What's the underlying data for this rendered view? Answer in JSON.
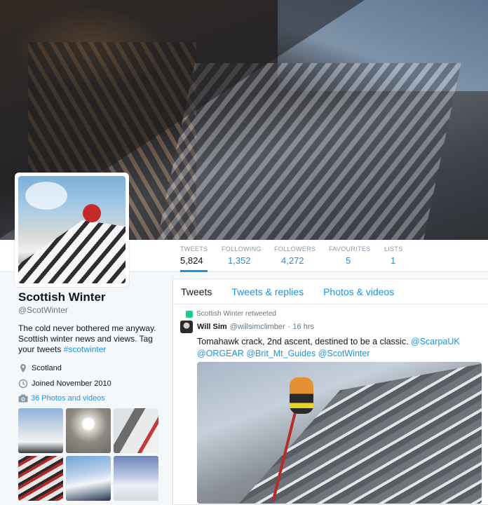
{
  "profile": {
    "name": "Scottish Winter",
    "handle": "@ScotWinter",
    "bio_text": "The cold never bothered me anyway. Scottish winter news and views. Tag your tweets ",
    "bio_hashtag": "#scotwinter",
    "location": "Scotland",
    "joined": "Joined November 2010",
    "photos_link": "36 Photos and videos"
  },
  "stats": [
    {
      "label": "TWEETS",
      "value": "5,824"
    },
    {
      "label": "FOLLOWING",
      "value": "1,352"
    },
    {
      "label": "FOLLOWERS",
      "value": "4,272"
    },
    {
      "label": "FAVOURITES",
      "value": "5"
    },
    {
      "label": "LISTS",
      "value": "1"
    }
  ],
  "tabs": [
    "Tweets",
    "Tweets & replies",
    "Photos & videos"
  ],
  "tweet": {
    "retweet_note": "Scottish Winter retweeted",
    "author_name": "Will Sim",
    "author_handle": "@willsimclimber",
    "time": "· 16 hrs",
    "text": "Tomahawk crack, 2nd ascent, destined to be a classic.",
    "mentions": [
      "@ScarpaUK",
      "@ORGEAR",
      "@Brit_Mt_Guides",
      "@ScotWinter"
    ]
  },
  "colors": {
    "accent": "#1b95e0",
    "retweet": "#19cf86"
  }
}
